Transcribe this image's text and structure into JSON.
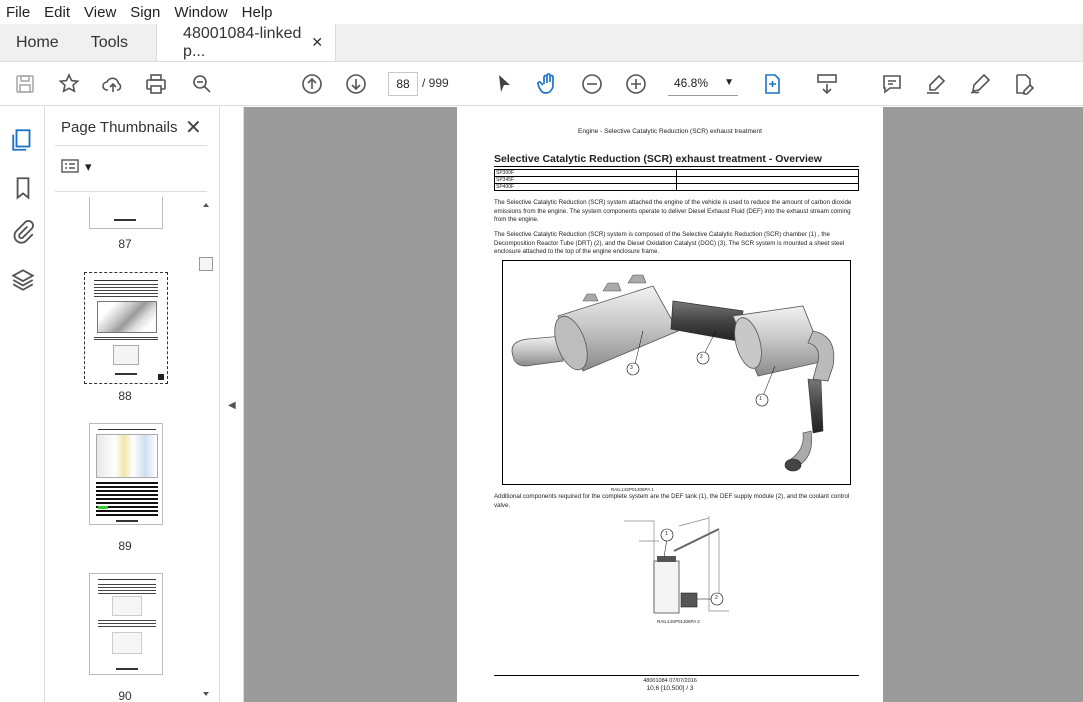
{
  "menu": [
    "File",
    "Edit",
    "View",
    "Sign",
    "Window",
    "Help"
  ],
  "tabs": {
    "home": "Home",
    "tools": "Tools",
    "doc": "48001084-linked p...",
    "doc_close": "✕"
  },
  "toolbar": {
    "current_page": "88",
    "total_pages": "/ 999",
    "zoom": "46.8%",
    "zoom_arrow": "▼"
  },
  "panel": {
    "title": "Page Thumbnails",
    "close": "✕",
    "options_arrow": "▾"
  },
  "thumbnails": [
    {
      "page": "87"
    },
    {
      "page": "88"
    },
    {
      "page": "89"
    },
    {
      "page": "90"
    }
  ],
  "collapse_arrow": "◀",
  "document": {
    "header": "Engine - Selective Catalytic Reduction (SCR) exhaust treatment",
    "title": "Selective Catalytic Reduction (SCR) exhaust treatment - Overview",
    "table_rows": [
      "SP300F",
      "SP345F",
      "SP400F"
    ],
    "para1": "The Selective Catalytic Reduction (SCR) system attached the engine of the vehicle is used to reduce the amount of carbon dioxide emissions from the engine. The system components operate to deliver Diesel Exhaust Fluid (DEF) into the exhaust stream coming from the engine.",
    "para2": "The Selective Catalytic Reduction (SCR) system is composed of the Selective Catalytic Reduction (SCR) chamber (1) , the Decomposition Reactor Tube (DRT) (2), and the Diesel Oxidation Catalyst (DOC) (3). The SCR system is mounted a sheet steel enclosure attached to the top of the engine enclosure frame.",
    "fig1_caption": "RAIL14SP01306PA    1",
    "fig1_callouts": [
      "3",
      "2",
      "1"
    ],
    "para3": "Additional components required for the complete system are the DEF tank (1), the DEF supply module (2), and the coolant control valve.",
    "fig2_caption": "RAIL14SP01306PA    2",
    "fig2_callouts": [
      "1",
      "2"
    ],
    "footer1": "48001084 07/07/2016",
    "footer2": "10.6 [10.500] / 3"
  },
  "colors": {
    "canvas": "#9b9b9b",
    "accent": "#1a73c8"
  }
}
